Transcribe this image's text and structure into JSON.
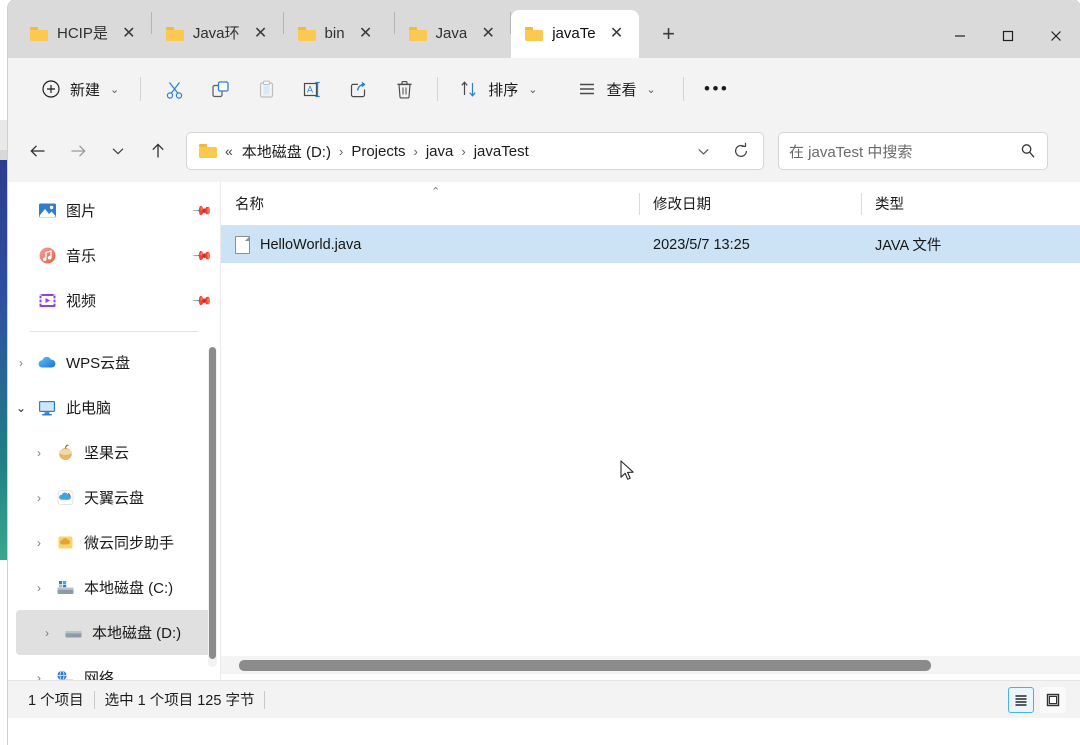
{
  "window": {
    "controls": {
      "minimize": "minimize-icon",
      "maximize": "maximize-icon",
      "close": "close-icon"
    }
  },
  "tabs": {
    "items": [
      {
        "label": "HCIP是",
        "icon": "folder-icon",
        "active": false
      },
      {
        "label": "Java环",
        "icon": "folder-icon",
        "active": false
      },
      {
        "label": "bin",
        "icon": "folder-icon",
        "active": false
      },
      {
        "label": "Java",
        "icon": "folder-icon",
        "active": false
      },
      {
        "label": "javaTe",
        "icon": "folder-icon",
        "active": true
      }
    ],
    "close_glyph": "✕",
    "new_tab_label": "+"
  },
  "toolbar": {
    "new_label": "新建",
    "new_icon": "plus-circle-icon",
    "cut_icon": "scissors-icon",
    "copy_icon": "copy-icon",
    "paste_icon": "paste-icon",
    "rename_icon": "rename-icon",
    "share_icon": "share-icon",
    "delete_icon": "trash-icon",
    "sort_label": "排序",
    "sort_icon": "sort-arrows-icon",
    "view_label": "查看",
    "view_icon": "hamburger-icon",
    "more_label": "•••",
    "chevron": "⌄"
  },
  "address": {
    "back_icon": "arrow-left-icon",
    "forward_icon": "arrow-right-icon",
    "recent_icon": "chevron-down-icon",
    "up_icon": "arrow-up-icon",
    "folder_icon": "folder-icon",
    "overflow": "«",
    "crumbs": [
      "本地磁盘 (D:)",
      "Projects",
      "java",
      "javaTest"
    ],
    "separator": "›",
    "dropdown_icon": "chevron-down-icon",
    "refresh_icon": "refresh-icon"
  },
  "search": {
    "placeholder": "在 javaTest 中搜索",
    "icon": "search-icon"
  },
  "sidebar": {
    "pinned": [
      {
        "label": "图片",
        "icon": "pictures-icon",
        "pin": "pin-icon"
      },
      {
        "label": "音乐",
        "icon": "music-icon",
        "pin": "pin-icon"
      },
      {
        "label": "视频",
        "icon": "video-icon",
        "pin": "pin-icon"
      }
    ],
    "tree": [
      {
        "label": "WPS云盘",
        "icon": "cloud-icon",
        "twisty": "›",
        "expanded": false,
        "indent": 0,
        "selected": false
      },
      {
        "label": "此电脑",
        "icon": "this-pc-icon",
        "twisty": "⌄",
        "expanded": true,
        "indent": 0,
        "selected": false
      },
      {
        "label": "坚果云",
        "icon": "nutstore-icon",
        "twisty": "›",
        "expanded": false,
        "indent": 1,
        "selected": false
      },
      {
        "label": "天翼云盘",
        "icon": "tianyi-cloud-icon",
        "twisty": "›",
        "expanded": false,
        "indent": 1,
        "selected": false
      },
      {
        "label": "微云同步助手",
        "icon": "weiyun-icon",
        "twisty": "›",
        "expanded": false,
        "indent": 1,
        "selected": false
      },
      {
        "label": "本地磁盘 (C:)",
        "icon": "system-drive-icon",
        "twisty": "›",
        "expanded": false,
        "indent": 1,
        "selected": false
      },
      {
        "label": "本地磁盘 (D:)",
        "icon": "drive-icon",
        "twisty": "›",
        "expanded": false,
        "indent": 1,
        "selected": true
      },
      {
        "label": "网络",
        "icon": "network-icon",
        "twisty": "›",
        "expanded": false,
        "indent": 0,
        "selected": false
      }
    ]
  },
  "filelist": {
    "columns": [
      {
        "label": "名称",
        "sorted": true,
        "sort_caret": "⌃"
      },
      {
        "label": "修改日期",
        "sorted": false
      },
      {
        "label": "类型",
        "sorted": false
      }
    ],
    "rows": [
      {
        "name": "HelloWorld.java",
        "modified": "2023/5/7 13:25",
        "type": "JAVA 文件",
        "icon": "file-icon",
        "selected": true
      }
    ]
  },
  "statusbar": {
    "item_count": "1 个项目",
    "selection": "选中 1 个项目  125 字节",
    "view_details_icon": "details-view-icon",
    "view_tiles_icon": "large-icons-view-icon",
    "details_active": true
  },
  "colors": {
    "selection_blue": "#cce3f5",
    "accent_blue": "#4ab0e8",
    "titlebar_gray": "#dadada",
    "toolbar_gray": "#f3f3f3",
    "folder_yellow": "#fcc84f"
  }
}
